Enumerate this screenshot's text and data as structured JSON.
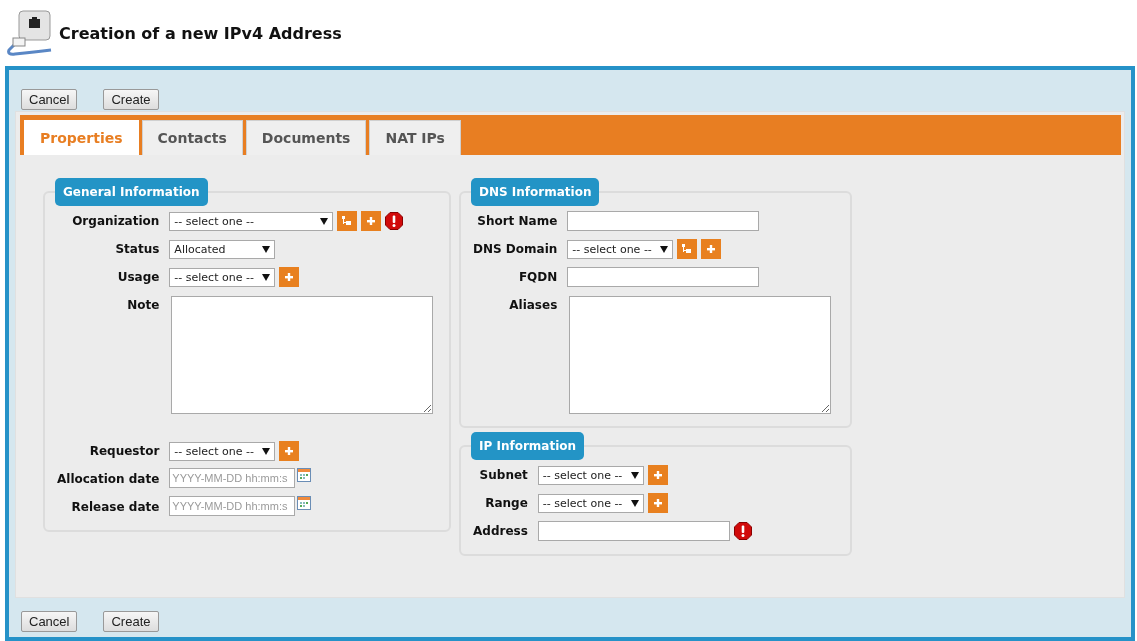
{
  "page": {
    "title": "Creation of a new IPv4 Address"
  },
  "toolbar_top": [
    "Cancel",
    "Create"
  ],
  "tabs": [
    {
      "label": "Properties",
      "selected": true
    },
    {
      "label": "Contacts",
      "selected": false
    },
    {
      "label": "Documents",
      "selected": false
    },
    {
      "label": "NAT IPs",
      "selected": false
    }
  ],
  "sections": [
    {
      "title": "General Information",
      "fields": [
        {
          "label": "Organization",
          "kind": "select",
          "value": "-- select one --",
          "actions": [
            {
              "kind": "tree"
            },
            {
              "kind": "add"
            }
          ],
          "invalid": true
        },
        {
          "label": "Status",
          "kind": "select",
          "value": "Allocated",
          "invalid": false
        },
        {
          "label": "Usage",
          "kind": "select",
          "value": "-- select one --",
          "actions": [
            {
              "kind": "add"
            }
          ],
          "invalid": false
        },
        {
          "label": "Note",
          "kind": "textarea",
          "invalid": false
        },
        {
          "label": "Requestor",
          "kind": "select",
          "value": "-- select one --",
          "actions": [
            {
              "kind": "add"
            }
          ],
          "invalid": false
        },
        {
          "label": "Allocation date",
          "kind": "date",
          "placeholder": "YYYY-MM-DD hh:mm:s",
          "invalid": false
        },
        {
          "label": "Release date",
          "kind": "date",
          "placeholder": "YYYY-MM-DD hh:mm:s",
          "invalid": false
        }
      ]
    },
    {
      "title": "DNS Information",
      "fields": [
        {
          "label": "Short Name",
          "kind": "text",
          "invalid": false
        },
        {
          "label": "DNS Domain",
          "kind": "select",
          "value": "-- select one --",
          "actions": [
            {
              "kind": "tree"
            },
            {
              "kind": "add"
            }
          ],
          "invalid": false
        },
        {
          "label": "FQDN",
          "kind": "text",
          "invalid": false
        },
        {
          "label": "Aliases",
          "kind": "textarea",
          "invalid": false
        }
      ]
    },
    {
      "title": "IP Information",
      "fields": [
        {
          "label": "Subnet",
          "kind": "select",
          "value": "-- select one --",
          "actions": [
            {
              "kind": "add"
            }
          ],
          "invalid": false
        },
        {
          "label": "Range",
          "kind": "select",
          "value": "-- select one --",
          "actions": [
            {
              "kind": "add"
            }
          ],
          "invalid": false
        },
        {
          "label": "Address",
          "kind": "text",
          "invalid": true
        }
      ]
    }
  ],
  "toolbar_bottom": [
    "Cancel",
    "Create"
  ]
}
